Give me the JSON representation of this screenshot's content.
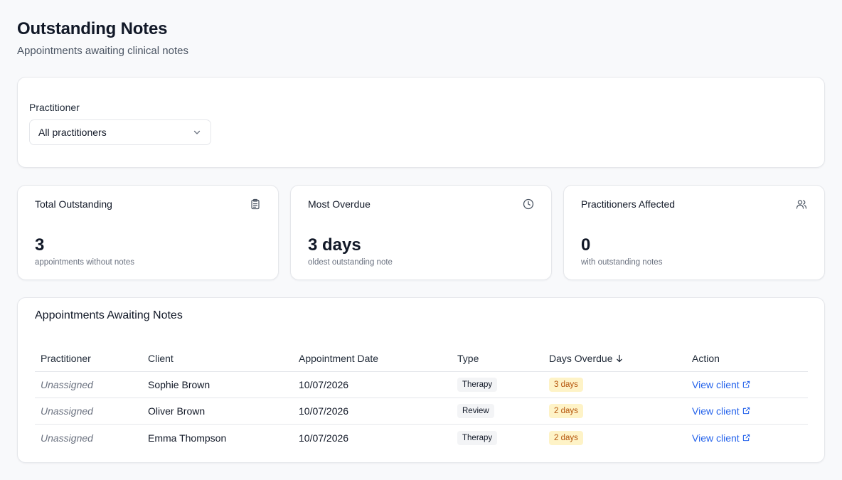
{
  "header": {
    "title": "Outstanding Notes",
    "subtitle": "Appointments awaiting clinical notes"
  },
  "filter": {
    "label": "Practitioner",
    "selected": "All practitioners"
  },
  "stats": [
    {
      "title": "Total Outstanding",
      "value": "3",
      "caption": "appointments without notes",
      "icon": "clipboard-icon"
    },
    {
      "title": "Most Overdue",
      "value": "3 days",
      "caption": "oldest outstanding note",
      "icon": "clock-icon"
    },
    {
      "title": "Practitioners Affected",
      "value": "0",
      "caption": "with outstanding notes",
      "icon": "users-icon"
    }
  ],
  "table": {
    "title": "Appointments Awaiting Notes",
    "columns": [
      "Practitioner",
      "Client",
      "Appointment Date",
      "Type",
      "Days Overdue",
      "Action"
    ],
    "rows": [
      {
        "practitioner": "Unassigned",
        "client": "Sophie Brown",
        "date": "10/07/2026",
        "type": "Therapy",
        "overdue": "3 days",
        "action": "View client"
      },
      {
        "practitioner": "Unassigned",
        "client": "Oliver Brown",
        "date": "10/07/2026",
        "type": "Review",
        "overdue": "2 days",
        "action": "View client"
      },
      {
        "practitioner": "Unassigned",
        "client": "Emma Thompson",
        "date": "10/07/2026",
        "type": "Therapy",
        "overdue": "2 days",
        "action": "View client"
      }
    ]
  },
  "colors": {
    "link": "#2563eb",
    "overdue_bg": "#fef3c7",
    "overdue_text": "#b45309",
    "type_bg": "#f3f4f6"
  }
}
